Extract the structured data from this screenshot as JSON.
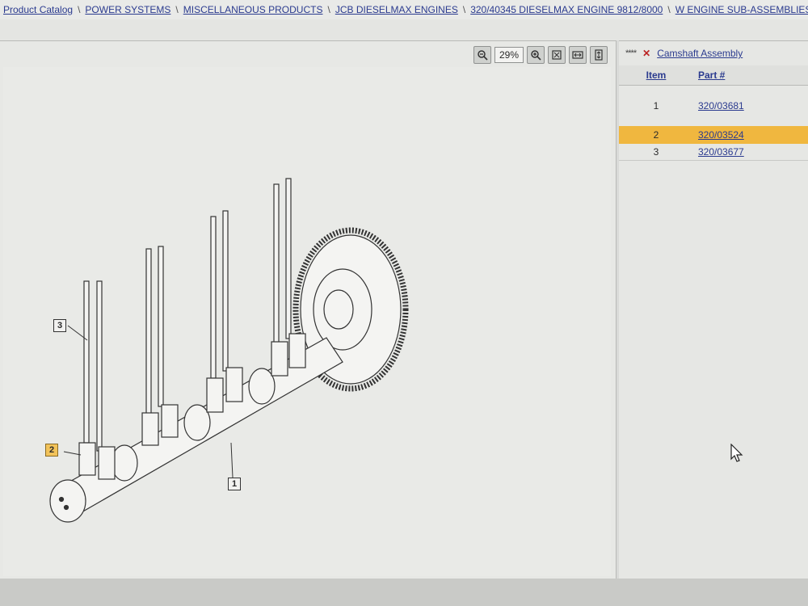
{
  "breadcrumb": [
    "Product Catalog",
    "POWER SYSTEMS",
    "MISCELLANEOUS PRODUCTS",
    "JCB DIESELMAX ENGINES",
    "320/40345 DIESELMAX ENGINE 9812/8000",
    "W ENGINE SUB-ASSEMBLIES"
  ],
  "toolbar": {
    "zoom_value": "29%",
    "icons": [
      "zoom-out-icon",
      "zoom-in-icon",
      "fit-icon",
      "fit-width-icon",
      "fit-height-icon"
    ]
  },
  "drawing": {
    "id": "OOXV0011460",
    "callouts": [
      "1",
      "2",
      "3"
    ],
    "highlighted_callout": "2"
  },
  "parts": {
    "stars": "****",
    "assembly_title": "Camshaft Assembly",
    "col_item": "Item",
    "col_part": "Part #",
    "rows": [
      {
        "item": "1",
        "part": "320/03681"
      },
      {
        "item": "2",
        "part": "320/03524"
      },
      {
        "item": "3",
        "part": "320/03677"
      }
    ],
    "selected_row": "2"
  },
  "colors": {
    "link": "#2b3b8f",
    "highlight": "#f0b73f"
  }
}
